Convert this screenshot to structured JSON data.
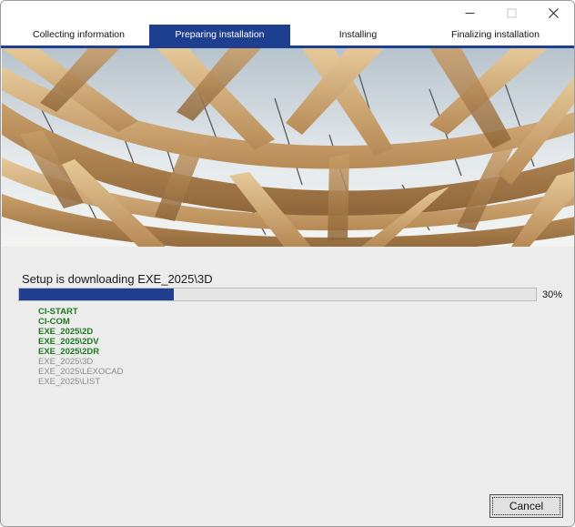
{
  "window": {
    "controls": {
      "minimize": "minimize-icon",
      "maximize": "maximize-icon",
      "close": "close-icon"
    }
  },
  "steps": [
    {
      "label": "Collecting information",
      "active": false
    },
    {
      "label": "Preparing installation",
      "active": true
    },
    {
      "label": "Installing",
      "active": false
    },
    {
      "label": "Finalizing installation",
      "active": false
    }
  ],
  "status": {
    "text": "Setup is downloading EXE_2025\\3D",
    "progress_percent": 30,
    "progress_label": "30%"
  },
  "components": [
    {
      "name": "CI-START",
      "state": "done"
    },
    {
      "name": "CI-COM",
      "state": "done"
    },
    {
      "name": "EXE_2025\\2D",
      "state": "done"
    },
    {
      "name": "EXE_2025\\2DV",
      "state": "done"
    },
    {
      "name": "EXE_2025\\2DR",
      "state": "done"
    },
    {
      "name": "EXE_2025\\3D",
      "state": "pending"
    },
    {
      "name": "EXE_2025\\LEXOCAD",
      "state": "pending"
    },
    {
      "name": "EXE_2025\\LIST",
      "state": "pending"
    }
  ],
  "buttons": {
    "cancel_label": "Cancel"
  },
  "colors": {
    "accent": "#1e3f8f",
    "done_text": "#1d7a1d",
    "pending_text": "#8c8c8c"
  }
}
